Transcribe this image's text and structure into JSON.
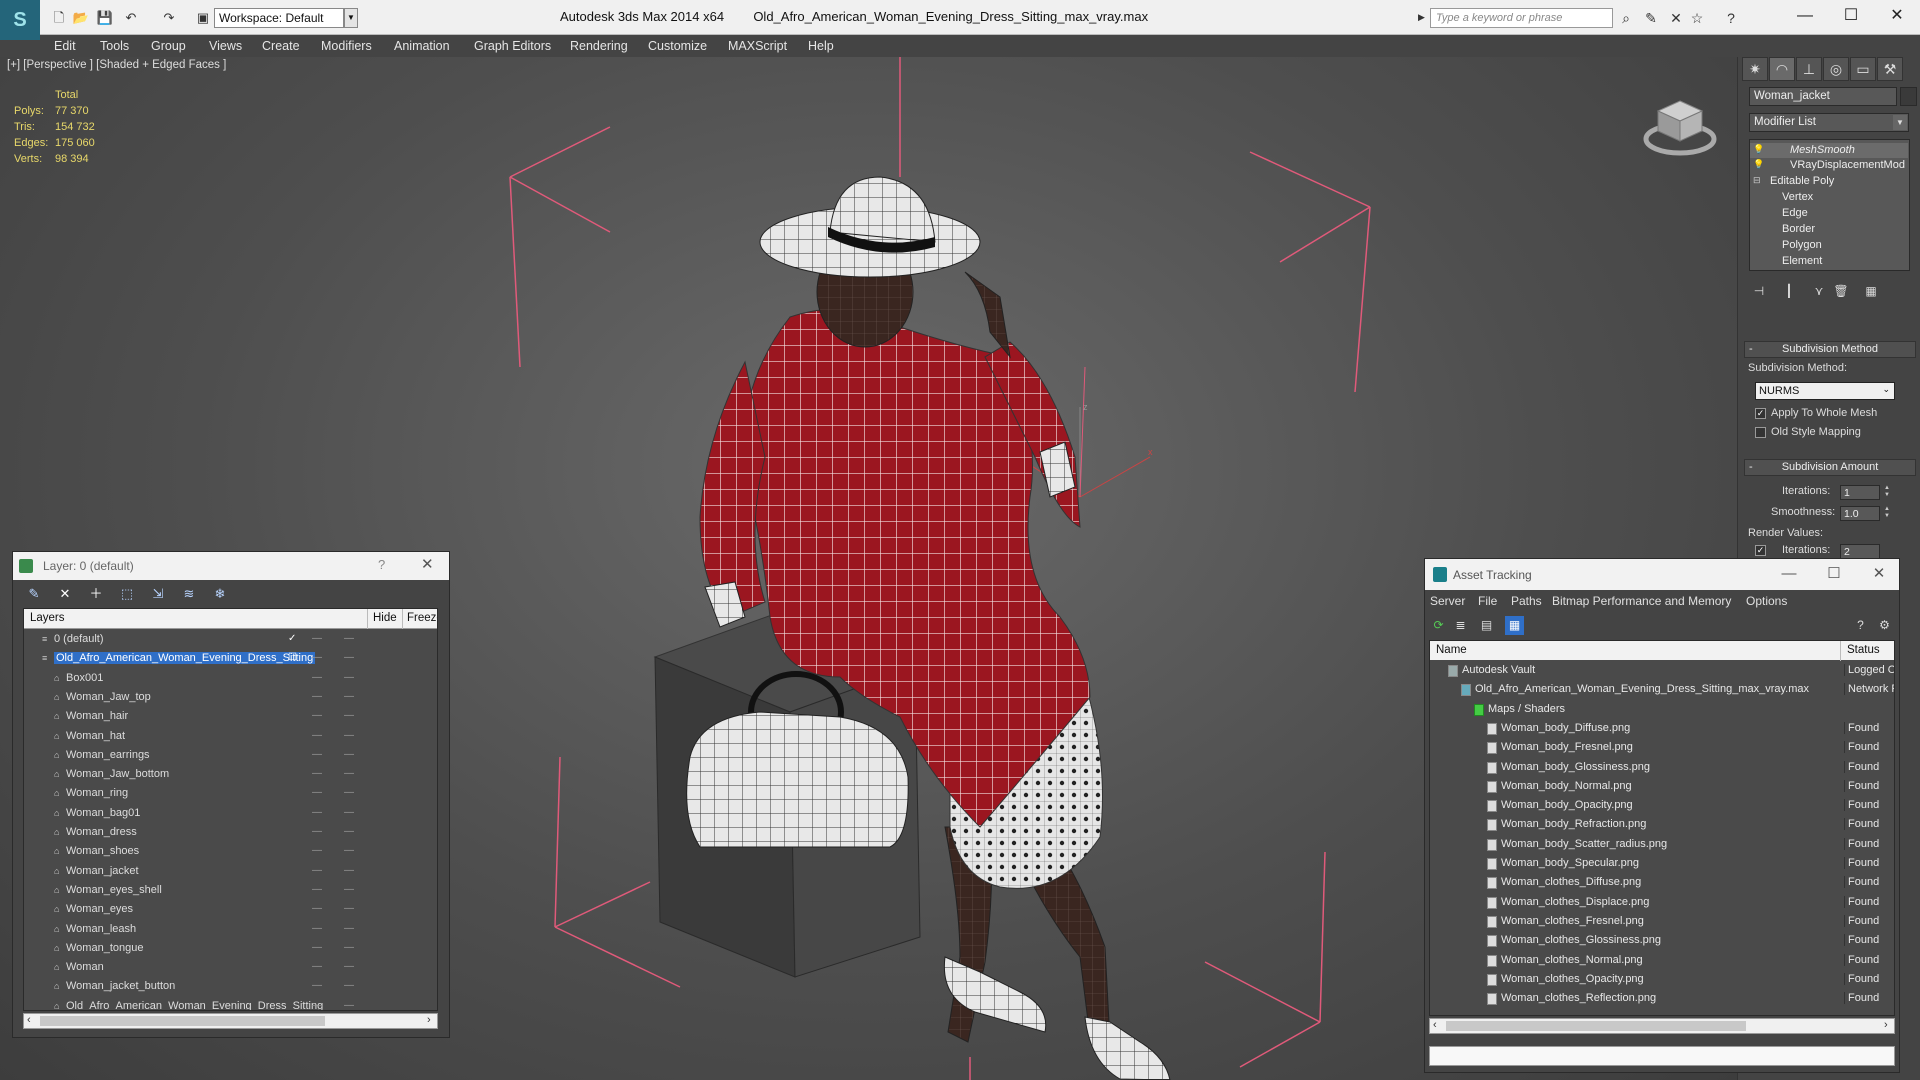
{
  "titlebar": {
    "app_name": "Autodesk 3ds Max  2014 x64",
    "file_name": "Old_Afro_American_Woman_Evening_Dress_Sitting_max_vray.max",
    "workspace": "Workspace: Default",
    "search_placeholder": "Type a keyword or phrase"
  },
  "menu": [
    "Edit",
    "Tools",
    "Group",
    "Views",
    "Create",
    "Modifiers",
    "Animation",
    "Graph Editors",
    "Rendering",
    "Customize",
    "MAXScript",
    "Help"
  ],
  "viewport": {
    "label": "[+] [Perspective ] [Shaded + Edged Faces ]",
    "stats": {
      "header": "Total",
      "rows": [
        {
          "label": "Polys:",
          "value": "77 370"
        },
        {
          "label": "Tris:",
          "value": "154 732"
        },
        {
          "label": "Edges:",
          "value": "175 060"
        },
        {
          "label": "Verts:",
          "value": "98 394"
        }
      ]
    },
    "gizmo_labels": {
      "z": "z",
      "y": "y",
      "x": "x"
    }
  },
  "command_panel": {
    "object_name": "Woman_jacket",
    "modifier_list": "Modifier List",
    "stack": [
      {
        "label": "MeshSmooth",
        "selected": true,
        "italic": true
      },
      {
        "label": "VRayDisplacementMod",
        "selected": false,
        "italic": false
      },
      {
        "label": "Editable Poly",
        "selected": false,
        "italic": false
      },
      {
        "label": "Vertex",
        "selected": false,
        "italic": false
      },
      {
        "label": "Edge",
        "selected": false,
        "italic": false
      },
      {
        "label": "Border",
        "selected": false,
        "italic": false
      },
      {
        "label": "Polygon",
        "selected": false,
        "italic": false
      },
      {
        "label": "Element",
        "selected": false,
        "italic": false
      }
    ],
    "subdivision_method": {
      "title": "Subdivision Method",
      "label": "Subdivision Method:",
      "value": "NURMS",
      "apply_whole_mesh": "Apply To Whole Mesh",
      "apply_whole_mesh_checked": true,
      "old_style_mapping": "Old Style Mapping",
      "old_style_mapping_checked": false
    },
    "subdivision_amount": {
      "title": "Subdivision Amount",
      "iterations_label": "Iterations:",
      "iterations": "1",
      "smoothness_label": "Smoothness:",
      "smoothness": "1.0",
      "render_values_label": "Render Values:",
      "render_iterations_label": "Iterations:",
      "render_iterations": "2"
    }
  },
  "layer_window": {
    "title": "Layer: 0 (default)",
    "columns": {
      "layers": "Layers",
      "hide": "Hide",
      "freeze": "Freeze"
    },
    "rows": [
      {
        "name": "0 (default)",
        "level": 0,
        "selected": false,
        "active": true
      },
      {
        "name": "Old_Afro_American_Woman_Evening_Dress_Sitting",
        "level": 0,
        "selected": true,
        "active": false
      },
      {
        "name": "Box001",
        "level": 1,
        "selected": false,
        "active": false
      },
      {
        "name": "Woman_Jaw_top",
        "level": 1,
        "selected": false,
        "active": false
      },
      {
        "name": "Woman_hair",
        "level": 1,
        "selected": false,
        "active": false
      },
      {
        "name": "Woman_hat",
        "level": 1,
        "selected": false,
        "active": false
      },
      {
        "name": "Woman_earrings",
        "level": 1,
        "selected": false,
        "active": false
      },
      {
        "name": "Woman_Jaw_bottom",
        "level": 1,
        "selected": false,
        "active": false
      },
      {
        "name": "Woman_ring",
        "level": 1,
        "selected": false,
        "active": false
      },
      {
        "name": "Woman_bag01",
        "level": 1,
        "selected": false,
        "active": false
      },
      {
        "name": "Woman_dress",
        "level": 1,
        "selected": false,
        "active": false
      },
      {
        "name": "Woman_shoes",
        "level": 1,
        "selected": false,
        "active": false
      },
      {
        "name": "Woman_jacket",
        "level": 1,
        "selected": false,
        "active": false
      },
      {
        "name": "Woman_eyes_shell",
        "level": 1,
        "selected": false,
        "active": false
      },
      {
        "name": "Woman_eyes",
        "level": 1,
        "selected": false,
        "active": false
      },
      {
        "name": "Woman_leash",
        "level": 1,
        "selected": false,
        "active": false
      },
      {
        "name": "Woman_tongue",
        "level": 1,
        "selected": false,
        "active": false
      },
      {
        "name": "Woman",
        "level": 1,
        "selected": false,
        "active": false
      },
      {
        "name": "Woman_jacket_button",
        "level": 1,
        "selected": false,
        "active": false
      },
      {
        "name": "Old_Afro_American_Woman_Evening_Dress_Sitting",
        "level": 1,
        "selected": false,
        "active": false
      }
    ]
  },
  "asset_window": {
    "title": "Asset Tracking",
    "menu": [
      "Server",
      "File",
      "Paths",
      "Bitmap Performance and Memory",
      "Options"
    ],
    "columns": {
      "name": "Name",
      "status": "Status"
    },
    "rows": [
      {
        "name": "Autodesk Vault",
        "level": 0,
        "status": "Logged Out",
        "kind": "vault"
      },
      {
        "name": "Old_Afro_American_Woman_Evening_Dress_Sitting_max_vray.max",
        "level": 1,
        "status": "Network Path",
        "kind": "scene"
      },
      {
        "name": "Maps / Shaders",
        "level": 2,
        "status": "",
        "kind": "folder"
      },
      {
        "name": "Woman_body_Diffuse.png",
        "level": 3,
        "status": "Found",
        "kind": "file"
      },
      {
        "name": "Woman_body_Fresnel.png",
        "level": 3,
        "status": "Found",
        "kind": "file"
      },
      {
        "name": "Woman_body_Glossiness.png",
        "level": 3,
        "status": "Found",
        "kind": "file"
      },
      {
        "name": "Woman_body_Normal.png",
        "level": 3,
        "status": "Found",
        "kind": "file"
      },
      {
        "name": "Woman_body_Opacity.png",
        "level": 3,
        "status": "Found",
        "kind": "file"
      },
      {
        "name": "Woman_body_Refraction.png",
        "level": 3,
        "status": "Found",
        "kind": "file"
      },
      {
        "name": "Woman_body_Scatter_radius.png",
        "level": 3,
        "status": "Found",
        "kind": "file"
      },
      {
        "name": "Woman_body_Specular.png",
        "level": 3,
        "status": "Found",
        "kind": "file"
      },
      {
        "name": "Woman_clothes_Diffuse.png",
        "level": 3,
        "status": "Found",
        "kind": "file"
      },
      {
        "name": "Woman_clothes_Displace.png",
        "level": 3,
        "status": "Found",
        "kind": "file"
      },
      {
        "name": "Woman_clothes_Fresnel.png",
        "level": 3,
        "status": "Found",
        "kind": "file"
      },
      {
        "name": "Woman_clothes_Glossiness.png",
        "level": 3,
        "status": "Found",
        "kind": "file"
      },
      {
        "name": "Woman_clothes_Normal.png",
        "level": 3,
        "status": "Found",
        "kind": "file"
      },
      {
        "name": "Woman_clothes_Opacity.png",
        "level": 3,
        "status": "Found",
        "kind": "file"
      },
      {
        "name": "Woman_clothes_Reflection.png",
        "level": 3,
        "status": "Found",
        "kind": "file"
      }
    ]
  },
  "colors": {
    "viewport_bg": "#5a5a5a",
    "ui_dark": "#444444",
    "stats_text": "#e8d86a",
    "grid_lines": "#e05a7a",
    "dress_red": "#9b1620",
    "selection_blue": "#2f6fc8"
  }
}
